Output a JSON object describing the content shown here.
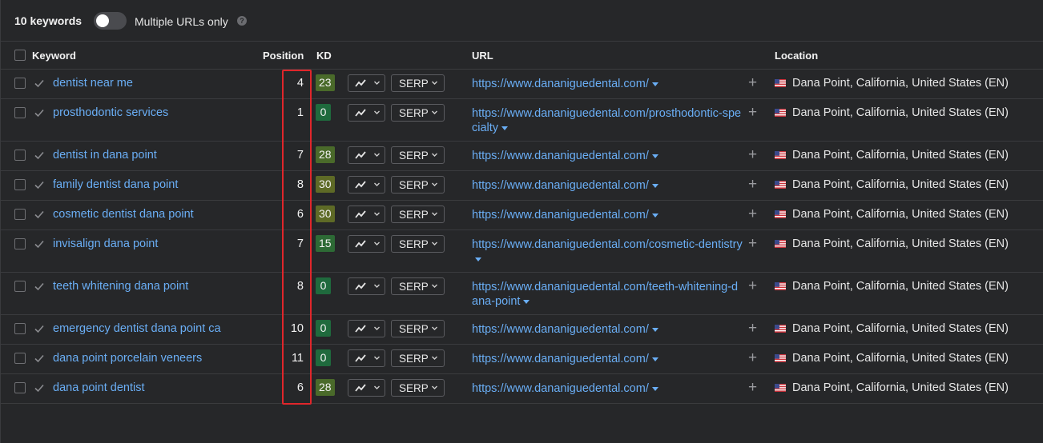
{
  "toolbar": {
    "keyword_count": "10 keywords",
    "multiple_urls_label": "Multiple URLs only",
    "multiple_urls_enabled": false,
    "help_glyph": "?"
  },
  "table": {
    "headers": {
      "keyword": "Keyword",
      "position": "Position",
      "kd": "KD",
      "url": "URL",
      "location": "Location"
    },
    "serp_label": "SERP",
    "rows": [
      {
        "keyword": "dentist near me",
        "position": "4",
        "kd": "23",
        "kd_color": "#4a6a2a",
        "url": "https://www.dananiguedental.com/",
        "location": "Dana Point, California, United States (EN)"
      },
      {
        "keyword": "prosthodontic services",
        "position": "1",
        "kd": "0",
        "kd_color": "#1f6a3d",
        "url": "https://www.dananiguedental.com/prosthodontic-specialty",
        "location": "Dana Point, California, United States (EN)"
      },
      {
        "keyword": "dentist in dana point",
        "position": "7",
        "kd": "28",
        "kd_color": "#4a6a2a",
        "url": "https://www.dananiguedental.com/",
        "location": "Dana Point, California, United States (EN)"
      },
      {
        "keyword": "family dentist dana point",
        "position": "8",
        "kd": "30",
        "kd_color": "#5e6a26",
        "url": "https://www.dananiguedental.com/",
        "location": "Dana Point, California, United States (EN)"
      },
      {
        "keyword": "cosmetic dentist dana point",
        "position": "6",
        "kd": "30",
        "kd_color": "#5e6a26",
        "url": "https://www.dananiguedental.com/",
        "location": "Dana Point, California, United States (EN)"
      },
      {
        "keyword": "invisalign dana point",
        "position": "7",
        "kd": "15",
        "kd_color": "#2d6a35",
        "url": "https://www.dananiguedental.com/cosmetic-dentistry",
        "location": "Dana Point, California, United States (EN)"
      },
      {
        "keyword": "teeth whitening dana point",
        "position": "8",
        "kd": "0",
        "kd_color": "#1f6a3d",
        "url": "https://www.dananiguedental.com/teeth-whitening-dana-point",
        "location": "Dana Point, California, United States (EN)"
      },
      {
        "keyword": "emergency dentist dana point ca",
        "position": "10",
        "kd": "0",
        "kd_color": "#1f6a3d",
        "url": "https://www.dananiguedental.com/",
        "location": "Dana Point, California, United States (EN)"
      },
      {
        "keyword": "dana point porcelain veneers",
        "position": "11",
        "kd": "0",
        "kd_color": "#1f6a3d",
        "url": "https://www.dananiguedental.com/",
        "location": "Dana Point, California, United States (EN)"
      },
      {
        "keyword": "dana point dentist",
        "position": "6",
        "kd": "28",
        "kd_color": "#4a6a2a",
        "url": "https://www.dananiguedental.com/",
        "location": "Dana Point, California, United States (EN)"
      }
    ]
  },
  "colors": {
    "background": "#262729",
    "link": "#6aaef5",
    "highlight": "#e0262b"
  }
}
